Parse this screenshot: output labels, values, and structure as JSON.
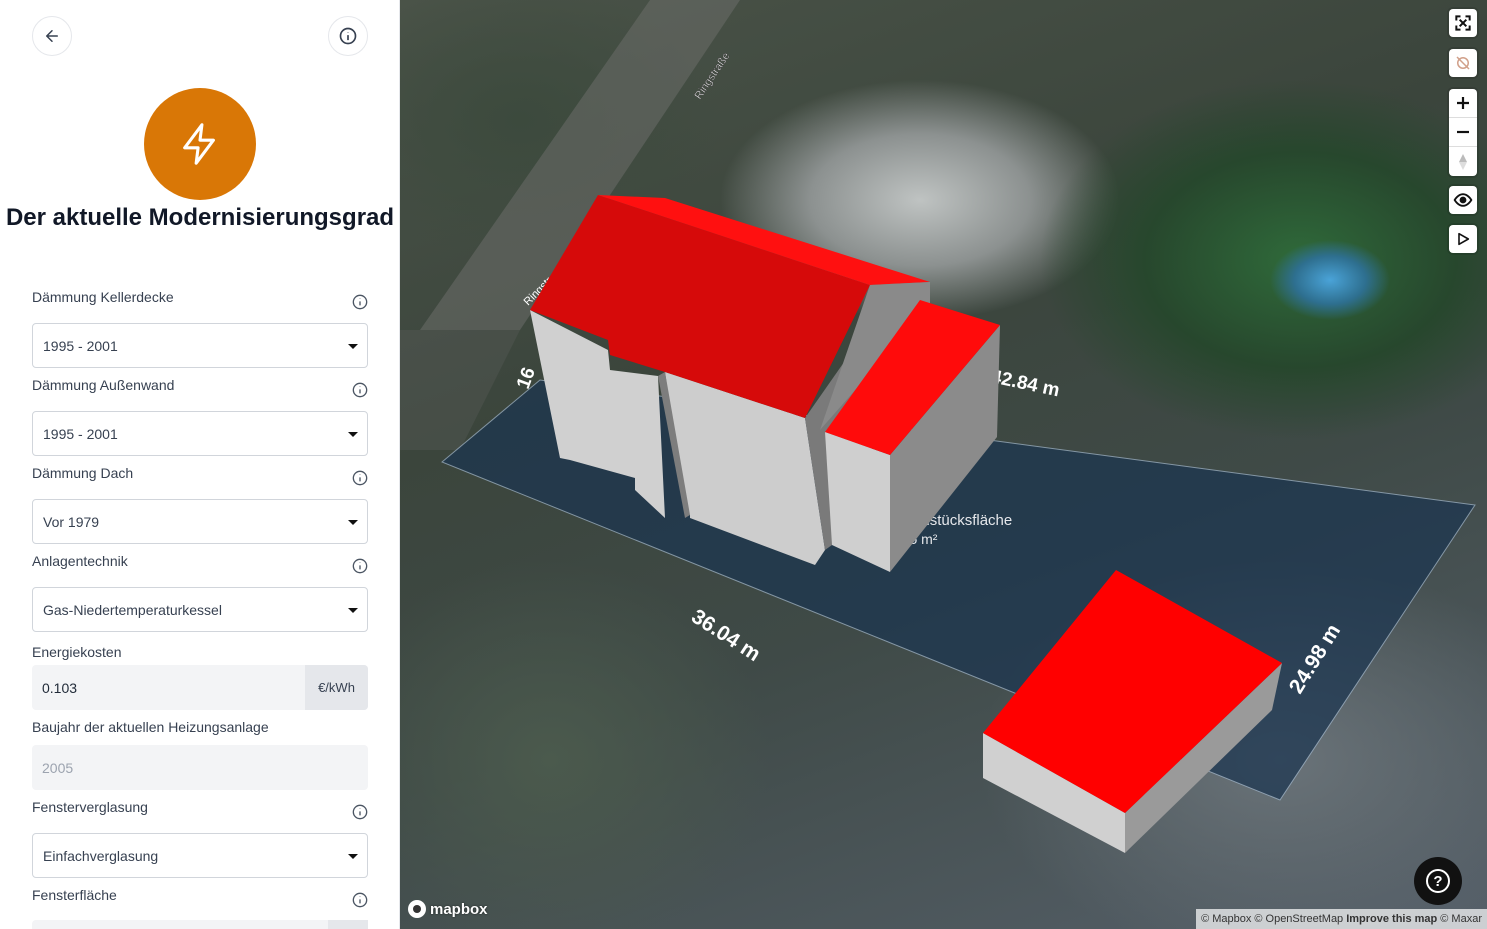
{
  "sidebar": {
    "title": "Der aktuelle Modernisierungsgrad",
    "fields": {
      "kellerdecke": {
        "label": "Dämmung Kellerdecke",
        "value": "1995 - 2001"
      },
      "aussenwand": {
        "label": "Dämmung Außenwand",
        "value": "1995 - 2001"
      },
      "dach": {
        "label": "Dämmung Dach",
        "value": "Vor 1979"
      },
      "anlagentechnik": {
        "label": "Anlagentechnik",
        "value": "Gas-Niedertemperaturkessel"
      },
      "energiekosten": {
        "label": "Energiekosten",
        "value": "0.103",
        "unit": "€/kWh"
      },
      "baujahr_heizung": {
        "label": "Baujahr der aktuellen Heizungsanlage",
        "placeholder": "2005"
      },
      "fensterverglasung": {
        "label": "Fensterverglasung",
        "value": "Einfachverglasung"
      },
      "fensterflaeche": {
        "label": "Fensterfläche"
      }
    },
    "accent_color": "#d97706"
  },
  "map": {
    "street_label_1": "Ringstraße",
    "street_label_2": "Ringstr",
    "dim_top_left": "16",
    "dim_top_right": "42.84 m",
    "dim_bottom": "36.04 m",
    "dim_right": "24.98 m",
    "area_label": "Grundstücksfläche",
    "area_value": "...25 m²",
    "mapbox_logo": "mapbox",
    "attribution": {
      "mapbox": "© Mapbox",
      "osm": "© OpenStreetMap",
      "improve": "Improve this map",
      "maxar": "© Maxar"
    },
    "help_label": "?",
    "roof_color": "#ff0000",
    "wall_color": "#cfcfcf"
  }
}
